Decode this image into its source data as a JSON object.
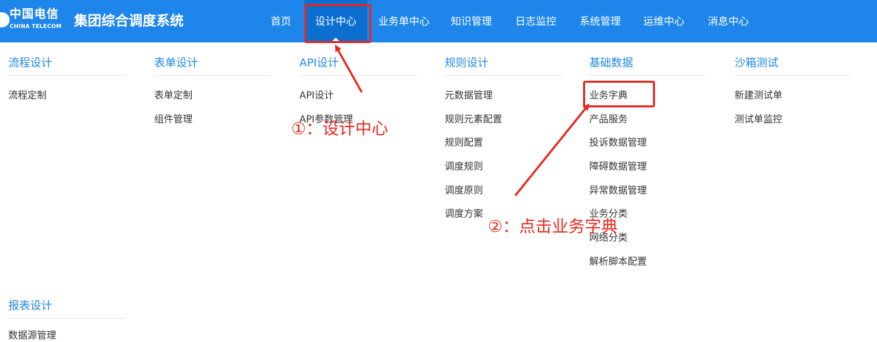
{
  "brand": {
    "logo_cn": "中国电信",
    "logo_en": "CHINA TELECOM",
    "system_title": "集团综合调度系统"
  },
  "nav": {
    "items": [
      {
        "label": "首页"
      },
      {
        "label": "设计中心"
      },
      {
        "label": "业务单中心"
      },
      {
        "label": "知识管理"
      },
      {
        "label": "日志监控"
      },
      {
        "label": "系统管理"
      },
      {
        "label": "运维中心"
      },
      {
        "label": "消息中心"
      }
    ]
  },
  "menu": {
    "columns": [
      {
        "title": "流程设计",
        "links": [
          "流程定制"
        ]
      },
      {
        "title": "表单设计",
        "links": [
          "表单定制",
          "组件管理"
        ]
      },
      {
        "title": "API设计",
        "links": [
          "API设计",
          "API参数管理"
        ]
      },
      {
        "title": "规则设计",
        "links": [
          "元数据管理",
          "规则元素配置",
          "规则配置",
          "调度规则",
          "调度原则",
          "调度方案"
        ]
      },
      {
        "title": "基础数据",
        "links": [
          "业务字典",
          "产品服务",
          "投诉数据管理",
          "障碍数据管理",
          "异常数据管理",
          "业务分类",
          "网络分类",
          "解析脚本配置"
        ]
      },
      {
        "title": "沙箱测试",
        "links": [
          "新建测试单",
          "测试单监控"
        ]
      },
      {
        "title": "报表设计",
        "links": [
          "数据源管理"
        ]
      }
    ]
  },
  "annotations": {
    "step1": "①：设计中心",
    "step2": "②：点击业务字典",
    "color": "#e8281f"
  },
  "colors": {
    "header_bg": "#1e86ea",
    "active_bg": "#0c6fd0",
    "column_title": "#1e86ea"
  }
}
